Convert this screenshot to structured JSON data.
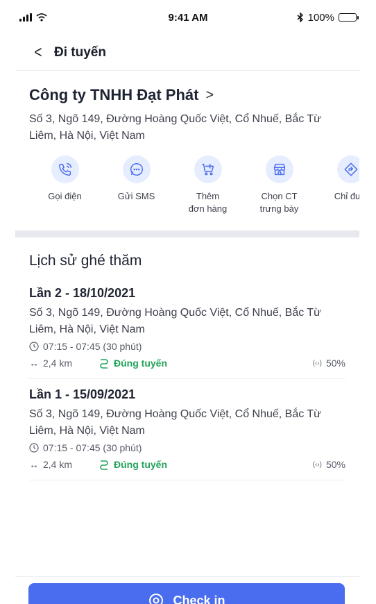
{
  "status_bar": {
    "time": "9:41 AM",
    "battery": "100%",
    "battery_level": 1.0
  },
  "header": {
    "title": "Đi tuyến"
  },
  "customer": {
    "name": "Công ty TNHH Đạt Phát",
    "address": "Số 3, Ngõ 149, Đường Hoàng Quốc Việt, Cổ Nhuế, Bắc Từ Liêm, Hà Nội, Việt Nam"
  },
  "actions": [
    {
      "label": "Gọi điện",
      "icon": "phone-icon"
    },
    {
      "label": "Gửi SMS",
      "icon": "sms-icon"
    },
    {
      "label": "Thêm\nđơn hàng",
      "icon": "cart-add-icon"
    },
    {
      "label": "Chọn CT\ntrưng bày",
      "icon": "store-icon"
    },
    {
      "label": "Chỉ đườ",
      "icon": "directions-icon"
    }
  ],
  "history": {
    "title": "Lịch sử ghé thăm",
    "visits": [
      {
        "title": "Lần 2 - 18/10/2021",
        "address": "Số 3, Ngõ 149, Đường Hoàng Quốc Việt, Cổ Nhuế, Bắc Từ Liêm, Hà Nội, Việt Nam",
        "time": "07:15 - 07:45 (30 phút)",
        "distance": "2,4 km",
        "route_status": "Đúng tuyến",
        "percent": "50%"
      },
      {
        "title": "Lần 1 - 15/09/2021",
        "address": "Số 3, Ngõ 149, Đường Hoàng Quốc Việt, Cổ Nhuế, Bắc Từ Liêm, Hà Nội, Việt Nam",
        "time": "07:15 - 07:45 (30 phút)",
        "distance": "2,4 km",
        "route_status": "Đúng tuyến",
        "percent": "50%"
      }
    ]
  },
  "checkin": {
    "label": "Check in"
  },
  "colors": {
    "accent": "#4a6df0",
    "success": "#21a35a",
    "icon_bg": "#e6edff"
  }
}
